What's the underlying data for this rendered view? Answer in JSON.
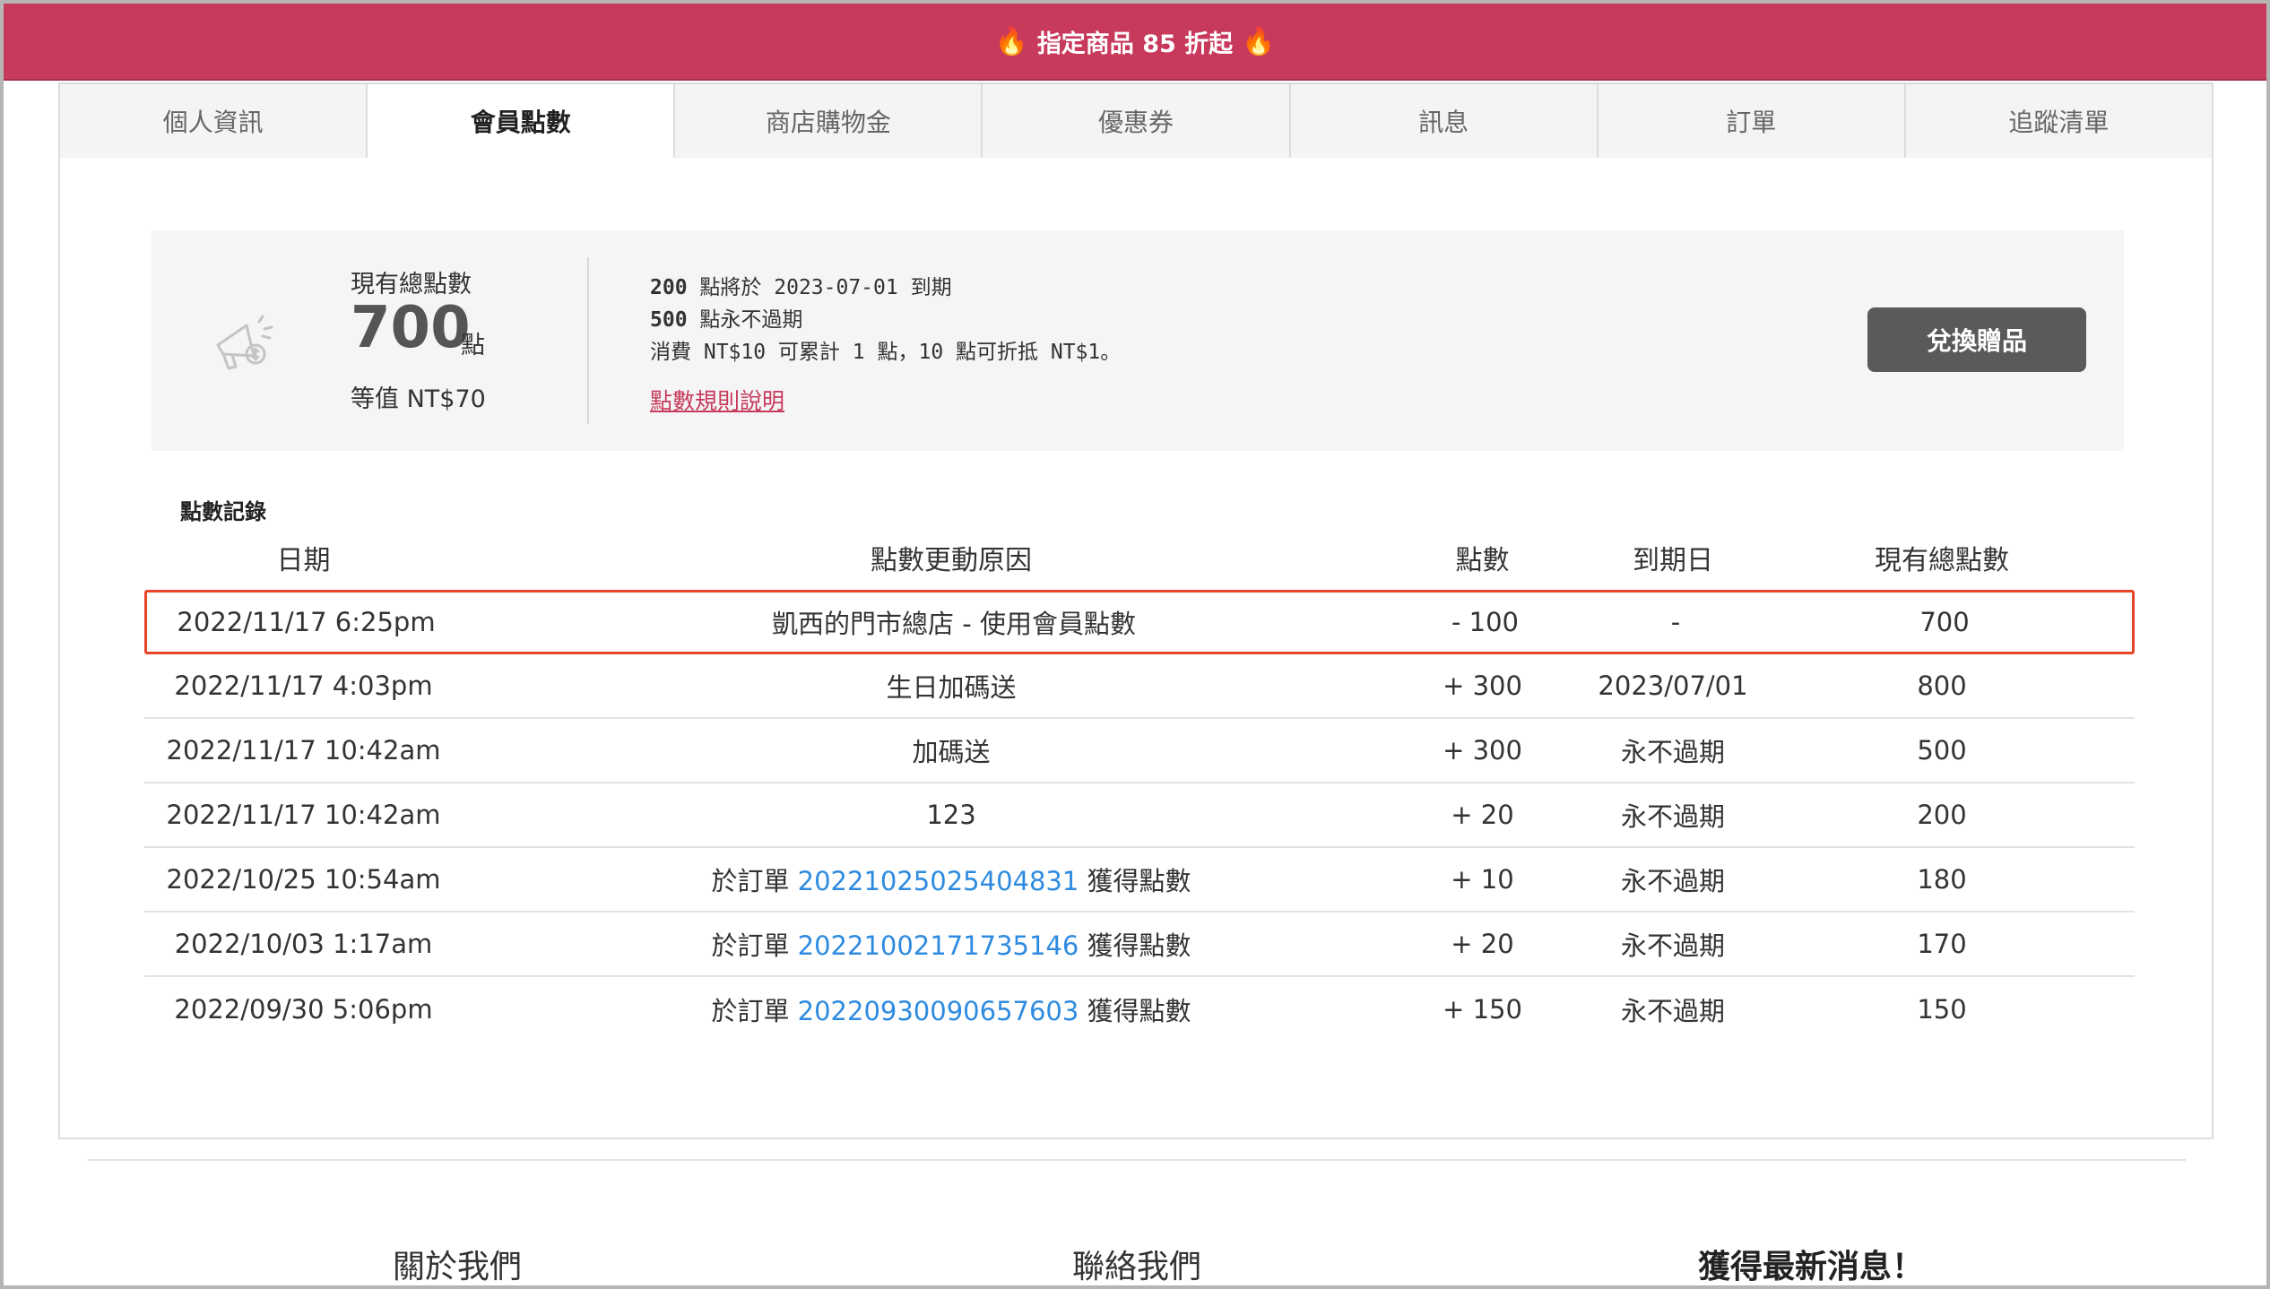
{
  "promo": {
    "text": "指定商品 85 折起"
  },
  "tabs": [
    {
      "label": "個人資訊",
      "active": false
    },
    {
      "label": "會員點數",
      "active": true
    },
    {
      "label": "商店購物金",
      "active": false
    },
    {
      "label": "優惠券",
      "active": false
    },
    {
      "label": "訊息",
      "active": false
    },
    {
      "label": "訂單",
      "active": false
    },
    {
      "label": "追蹤清單",
      "active": false
    }
  ],
  "summary": {
    "total_label": "現有總點數",
    "total_value": "700",
    "total_unit": "點",
    "equiv": "等值 NT$70",
    "expiring_points": "200",
    "expiring_text": "點將於 2023-07-01 到期",
    "permanent_points": "500",
    "permanent_text": "點永不過期",
    "earn_rule": "消費 NT$10 可累計 1 點，10 點可折抵 NT$1。",
    "rules_link": "點數規則說明",
    "redeem_button": "兌換贈品"
  },
  "records": {
    "title": "點數記錄",
    "headers": {
      "date": "日期",
      "reason": "點數更動原因",
      "points": "點數",
      "expiry": "到期日",
      "total": "現有總點數"
    },
    "rows": [
      {
        "date": "2022/11/17 6:25pm",
        "reason_prefix": "凱西的門市總店 - 使用會員點數",
        "order": "",
        "reason_suffix": "",
        "points": "- 100",
        "expiry": "-",
        "total": "700"
      },
      {
        "date": "2022/11/17 4:03pm",
        "reason_prefix": "生日加碼送",
        "order": "",
        "reason_suffix": "",
        "points": "+ 300",
        "expiry": "2023/07/01",
        "total": "800"
      },
      {
        "date": "2022/11/17 10:42am",
        "reason_prefix": "加碼送",
        "order": "",
        "reason_suffix": "",
        "points": "+ 300",
        "expiry": "永不過期",
        "total": "500"
      },
      {
        "date": "2022/11/17 10:42am",
        "reason_prefix": "123",
        "order": "",
        "reason_suffix": "",
        "points": "+ 20",
        "expiry": "永不過期",
        "total": "200"
      },
      {
        "date": "2022/10/25 10:54am",
        "reason_prefix": "於訂單 ",
        "order": "20221025025404831",
        "reason_suffix": " 獲得點數",
        "points": "+ 10",
        "expiry": "永不過期",
        "total": "180"
      },
      {
        "date": "2022/10/03 1:17am",
        "reason_prefix": "於訂單 ",
        "order": "20221002171735146",
        "reason_suffix": " 獲得點數",
        "points": "+ 20",
        "expiry": "永不過期",
        "total": "170"
      },
      {
        "date": "2022/09/30 5:06pm",
        "reason_prefix": "於訂單 ",
        "order": "20220930090657603",
        "reason_suffix": " 獲得點數",
        "points": "+ 150",
        "expiry": "永不過期",
        "total": "150"
      }
    ]
  },
  "footer": {
    "about": "關於我們",
    "contact": "聯絡我們",
    "news": "獲得最新消息！"
  },
  "colors": {
    "promo_bg": "#c73a5c",
    "link_blue": "#2f8be0",
    "highlight_border": "#e8442a",
    "button_bg": "#5a5a5a"
  }
}
